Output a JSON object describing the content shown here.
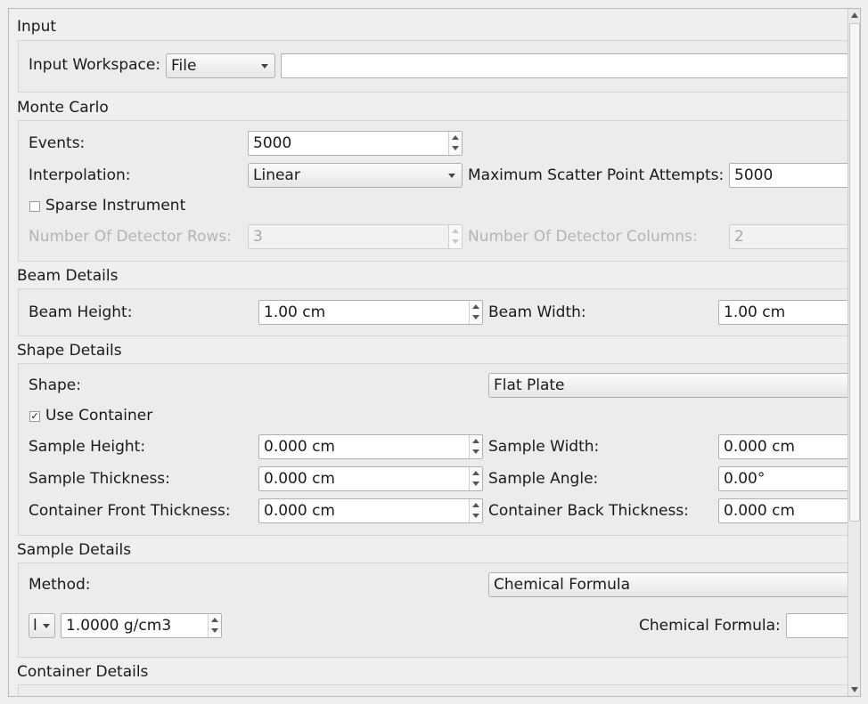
{
  "input": {
    "title": "Input",
    "workspace_label": "Input Workspace:",
    "workspace_type": "File",
    "workspace_path": ""
  },
  "monte_carlo": {
    "title": "Monte Carlo",
    "events_label": "Events:",
    "events_value": "5000",
    "interpolation_label": "Interpolation:",
    "interpolation_value": "Linear",
    "max_attempts_label": "Maximum Scatter Point Attempts:",
    "max_attempts_value": "5000",
    "sparse_label": "Sparse Instrument",
    "sparse_checked": false,
    "rows_label": "Number Of Detector Rows:",
    "rows_value": "3",
    "columns_label": "Number Of Detector Columns:",
    "columns_value": "2"
  },
  "beam": {
    "title": "Beam Details",
    "height_label": "Beam Height:",
    "height_value": "1.00 cm",
    "width_label": "Beam Width:",
    "width_value": "1.00 cm"
  },
  "shape": {
    "title": "Shape Details",
    "shape_label": "Shape:",
    "shape_value": "Flat Plate",
    "use_container_label": "Use Container",
    "use_container_checked": true,
    "check_glyph": "✓",
    "sample_height_label": "Sample Height:",
    "sample_height_value": "0.000 cm",
    "sample_width_label": "Sample Width:",
    "sample_width_value": "0.000 cm",
    "sample_thickness_label": "Sample Thickness:",
    "sample_thickness_value": "0.000 cm",
    "sample_angle_label": "Sample Angle:",
    "sample_angle_value": "0.00°",
    "front_thickness_label": "Container Front Thickness:",
    "front_thickness_value": "0.000 cm",
    "back_thickness_label": "Container Back Thickness:",
    "back_thickness_value": "0.000 cm"
  },
  "sample": {
    "title": "Sample Details",
    "method_label": "Method:",
    "method_value": "Chemical Formula",
    "density_type": "l",
    "density_value": "1.0000 g/cm3",
    "formula_label": "Chemical Formula:",
    "formula_value": ""
  },
  "container": {
    "title": "Container Details"
  }
}
